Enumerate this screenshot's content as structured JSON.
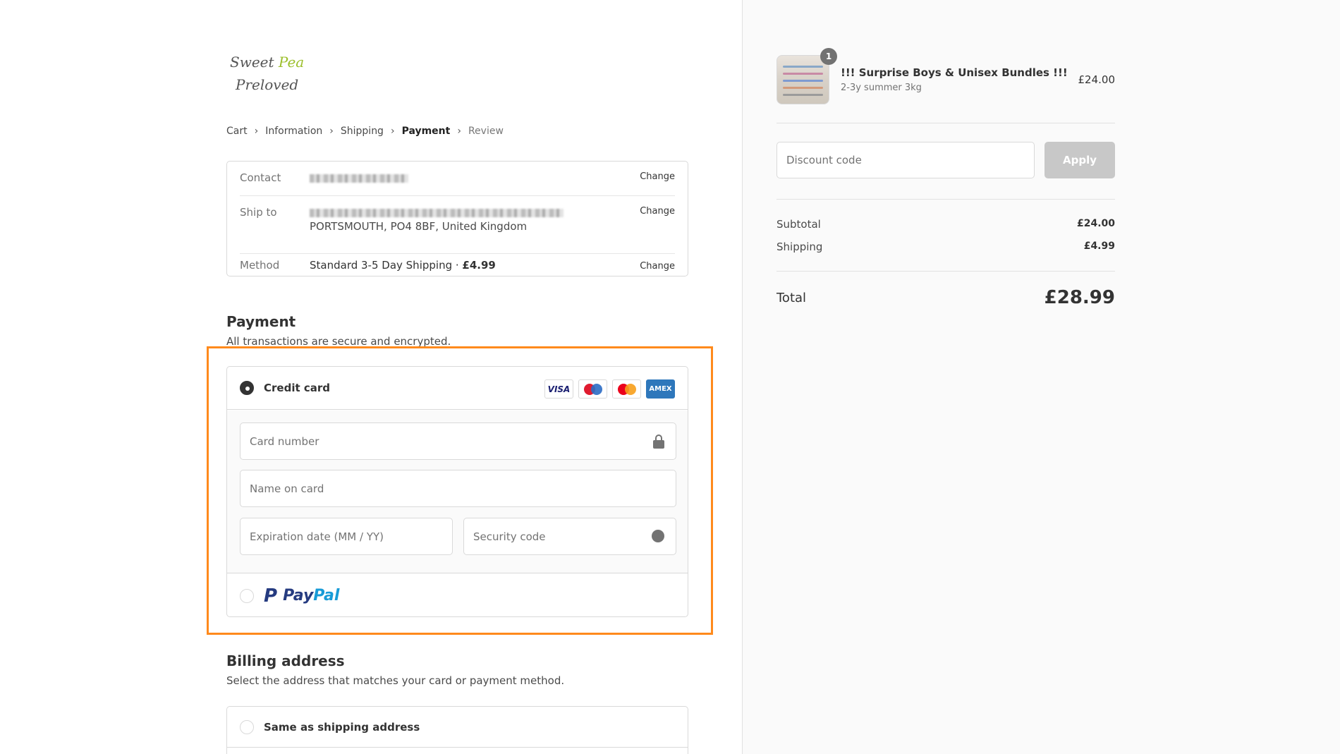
{
  "logo": {
    "line1_a": "Sweet ",
    "line1_b": "Pea",
    "line2": "Preloved"
  },
  "breadcrumb": {
    "items": [
      "Cart",
      "Information",
      "Shipping",
      "Payment",
      "Review"
    ],
    "separator": "›"
  },
  "review": {
    "contact_label": "Contact",
    "shipto_label": "Ship to",
    "shipto_line2": "PORTSMOUTH, PO4 8BF, United Kingdom",
    "method_label": "Method",
    "method_value_a": "Standard 3-5 Day Shipping · ",
    "method_value_b": "£4.99",
    "change_label": "Change"
  },
  "payment": {
    "title": "Payment",
    "subtitle": "All transactions are secure and encrypted.",
    "credit_card_label": "Credit card",
    "card_brands": [
      "VISA",
      "maestro",
      "mastercard",
      "AMEX"
    ],
    "card_number_placeholder": "Card number",
    "name_placeholder": "Name on card",
    "expiry_placeholder": "Expiration date (MM / YY)",
    "security_placeholder": "Security code",
    "paypal_pay": "Pay",
    "paypal_pal": "Pal",
    "help_glyph": "?",
    "paypal_glyph": "P"
  },
  "billing": {
    "title": "Billing address",
    "subtitle": "Select the address that matches your card or payment method.",
    "same_as_shipping": "Same as shipping address"
  },
  "summary": {
    "product_name": "!!! Surprise Boys & Unisex Bundles !!!",
    "product_variant": "2-3y summer 3kg",
    "product_price": "£24.00",
    "quantity": "1",
    "discount_placeholder": "Discount code",
    "apply_label": "Apply",
    "subtotal_label": "Subtotal",
    "subtotal_value": "£24.00",
    "shipping_label": "Shipping",
    "shipping_value": "£4.99",
    "total_label": "Total",
    "total_value": "£28.99"
  },
  "colors": {
    "highlight": "#ff8a1c",
    "logo_accent": "#9cbf2b",
    "paypal_dark": "#253b80",
    "paypal_light": "#179bd7"
  }
}
